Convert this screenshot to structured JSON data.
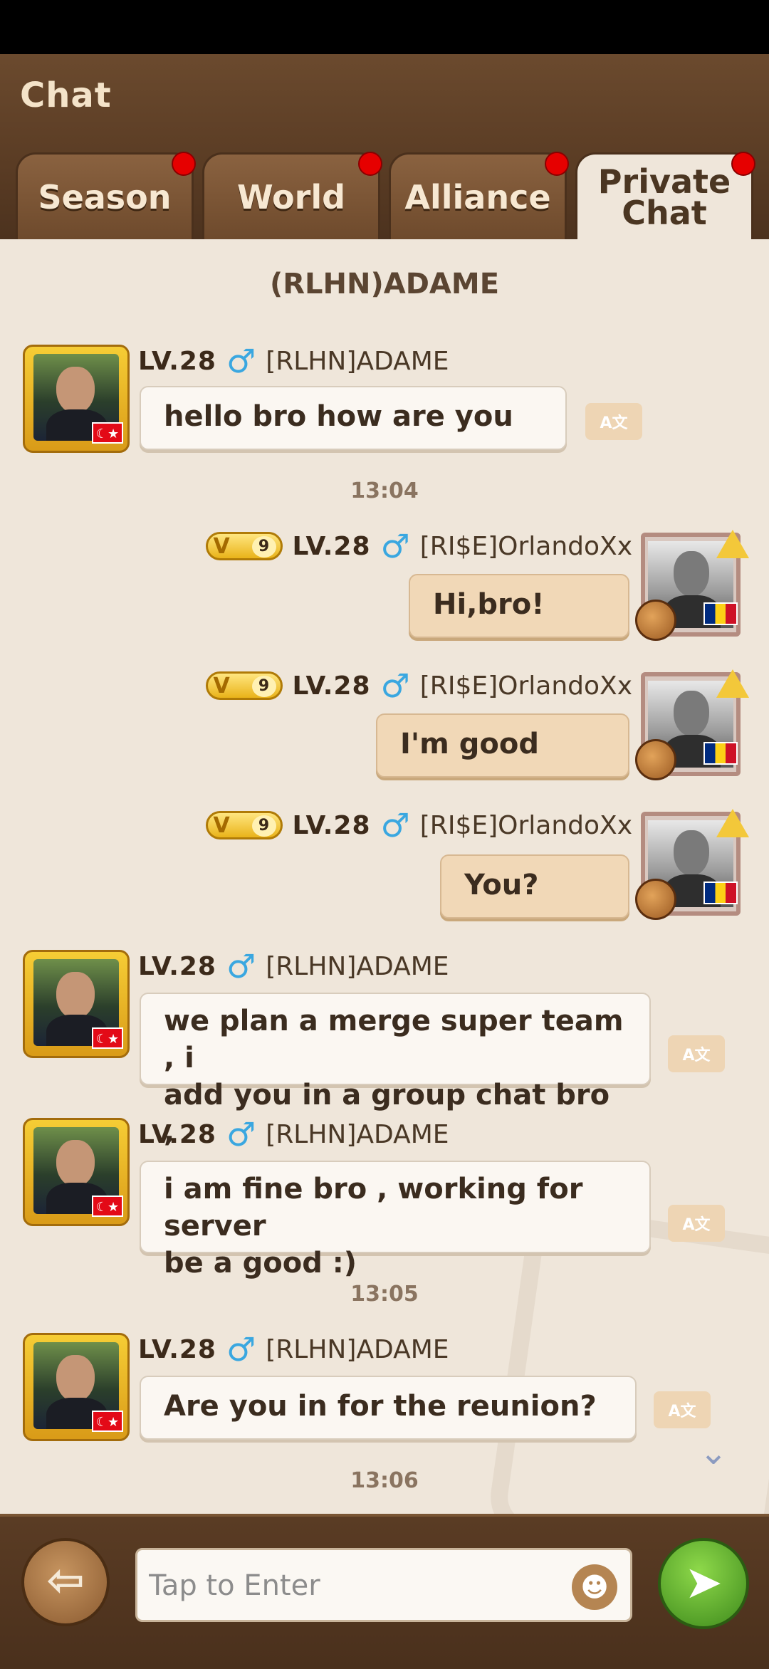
{
  "app": {
    "title": "Chat"
  },
  "tabs": [
    {
      "label": "Season",
      "has_notification": true
    },
    {
      "label": "World",
      "has_notification": true
    },
    {
      "label": "Alliance",
      "has_notification": true
    },
    {
      "label": "Private Chat",
      "line1": "Private",
      "line2": "Chat",
      "active": true,
      "has_notification": true
    }
  ],
  "conversation": {
    "title": "(RLHN)ADAME"
  },
  "messages": [
    {
      "side": "left",
      "level": "LV.28",
      "gender": "♂",
      "name": "[RLHN]ADAME",
      "lines": [
        "hello bro how are you"
      ]
    },
    {
      "timestamp": "13:04"
    },
    {
      "side": "right",
      "vip": "9",
      "level": "LV.28",
      "gender": "♂",
      "name": "[RI$E]OrlandoXx",
      "lines": [
        "Hi,bro!"
      ]
    },
    {
      "side": "right",
      "vip": "9",
      "level": "LV.28",
      "gender": "♂",
      "name": "[RI$E]OrlandoXx",
      "lines": [
        "I'm  good"
      ]
    },
    {
      "side": "right",
      "vip": "9",
      "level": "LV.28",
      "gender": "♂",
      "name": "[RI$E]OrlandoXx",
      "lines": [
        "You?"
      ]
    },
    {
      "side": "left",
      "level": "LV.28",
      "gender": "♂",
      "name": "[RLHN]ADAME",
      "lines": [
        "we plan a merge super team , i",
        "add you in a group chat bro ,"
      ]
    },
    {
      "side": "left",
      "level": "LV.28",
      "gender": "♂",
      "name": "[RLHN]ADAME",
      "lines": [
        "i am fine bro , working for server",
        "be a good :)"
      ]
    },
    {
      "timestamp": "13:05"
    },
    {
      "side": "left",
      "level": "LV.28",
      "gender": "♂",
      "name": "[RLHN]ADAME",
      "lines": [
        "Are you in for the reunion?"
      ]
    },
    {
      "timestamp": "13:06"
    }
  ],
  "input": {
    "placeholder": "Tap to Enter"
  },
  "icons": {
    "back": "back-arrow-icon",
    "emoji": "smiley-icon",
    "send": "send-icon",
    "translate": "translate-icon",
    "scroll": "chevron-down-icon",
    "vip_badge": "vip-badge-icon"
  },
  "colors": {
    "header_bg": "#5a3c24",
    "chat_bg": "#efe6da",
    "notification_dot": "#e60000",
    "own_bubble": "#f1d8b7",
    "other_bubble": "#fbf7f2",
    "gender_male": "#3aa7e0",
    "send_button": "#5fb52c"
  },
  "vip_letter": "V",
  "glyphs": {
    "back": "⇦",
    "send": "➤",
    "emoji": "☻",
    "translate": "A文",
    "chevron": "⌄",
    "flag_tr": "☾★"
  }
}
